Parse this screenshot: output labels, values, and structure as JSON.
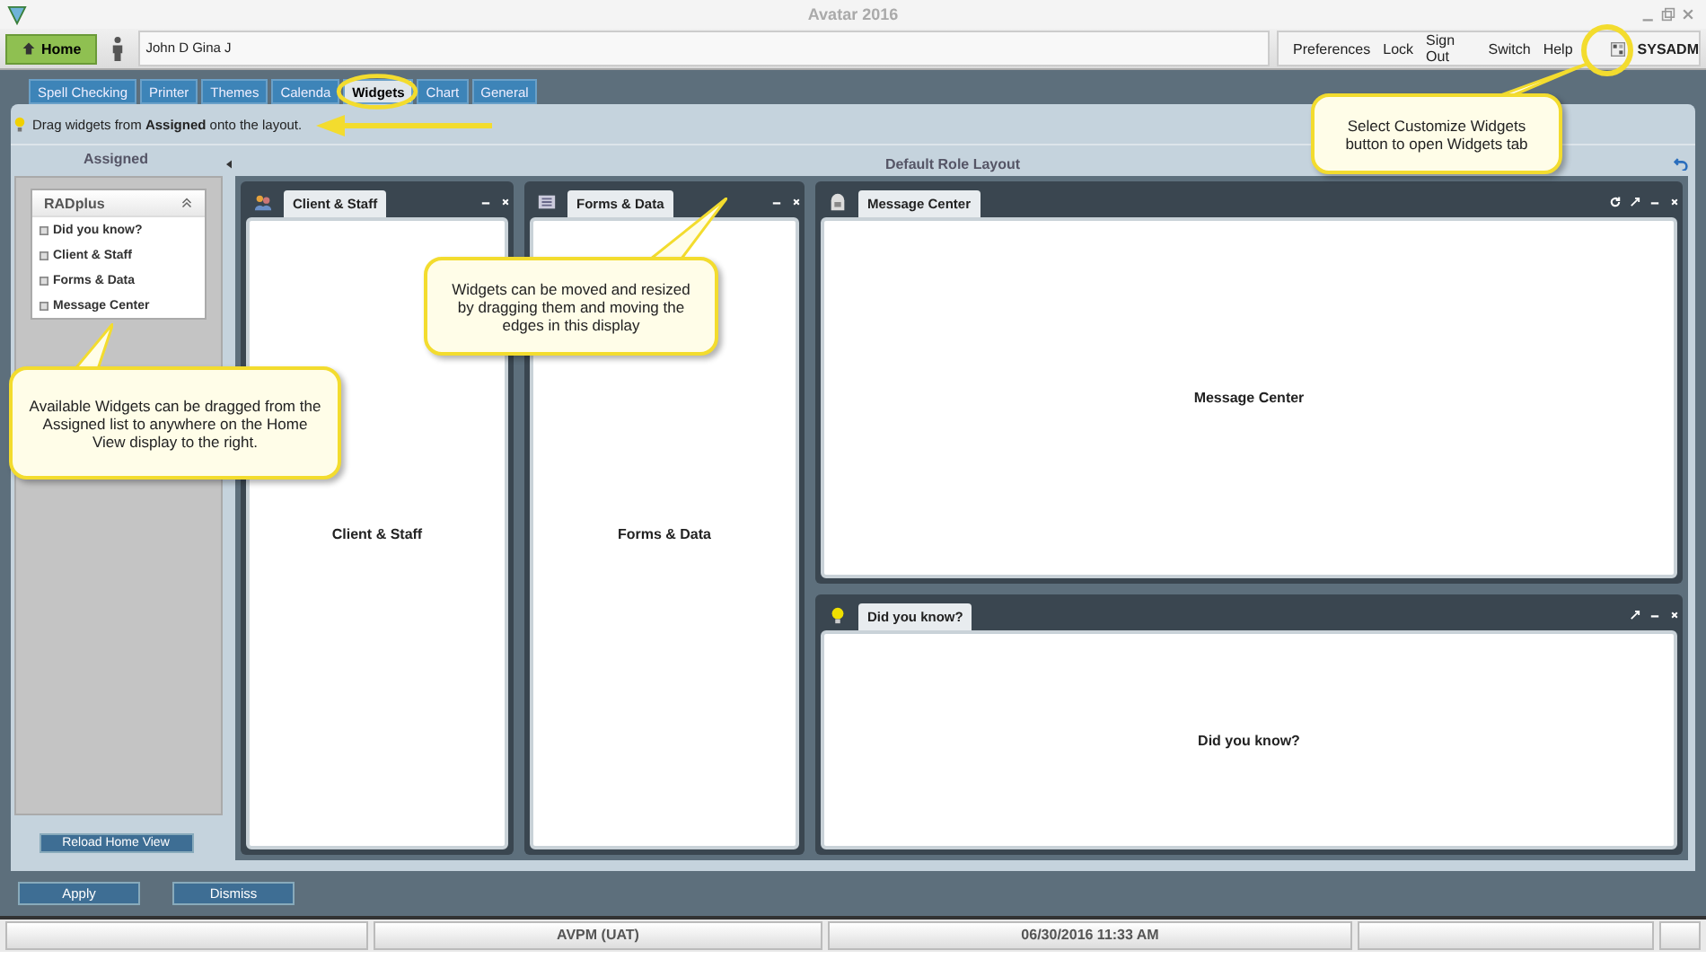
{
  "window": {
    "title": "Avatar 2016"
  },
  "top_bar": {
    "home_button": "Home",
    "patients": "John D  Gina J",
    "links": [
      "Preferences",
      "Lock",
      "Sign Out",
      "Switch",
      "Help"
    ],
    "user": "SYSADM"
  },
  "tabs": [
    {
      "label": "Spell Checking",
      "selected": false
    },
    {
      "label": "Printer",
      "selected": false
    },
    {
      "label": "Themes",
      "selected": false
    },
    {
      "label": "Calenda",
      "selected": false
    },
    {
      "label": "Widgets",
      "selected": true
    },
    {
      "label": "Chart",
      "selected": false
    },
    {
      "label": "General",
      "selected": false
    }
  ],
  "hint": "Drag widgets from **Assigned** onto the layout.",
  "assigned": {
    "title": "Assigned",
    "group": {
      "title": "RADplus",
      "items": [
        "Did you know?",
        "Client & Staff",
        "Forms & Data",
        "Message Center"
      ]
    },
    "reload_button": "Reload Home View"
  },
  "layout": {
    "title": "Default Role Layout",
    "widgets": [
      {
        "kind": "people",
        "title": "Client & Staff",
        "body": "Client & Staff"
      },
      {
        "kind": "form",
        "title": "Forms & Data",
        "body": "Forms & Data"
      },
      {
        "kind": "mail",
        "title": "Message Center",
        "body": "Message Center"
      },
      {
        "kind": "bulb",
        "title": "Did you know?",
        "body": "Did you know?"
      }
    ]
  },
  "buttons": [
    "Apply",
    "Dismiss"
  ],
  "status_bar": {
    "environment": "AVPM (UAT)",
    "datetime": "06/30/2016 11:33 AM"
  },
  "callouts": [
    "Select Customize Widgets button to open Widgets tab",
    "Widgets can be moved and resized by dragging them and moving the edges in this display",
    "Available Widgets can be dragged from the Assigned list to anywhere on the Home View display to the right."
  ]
}
